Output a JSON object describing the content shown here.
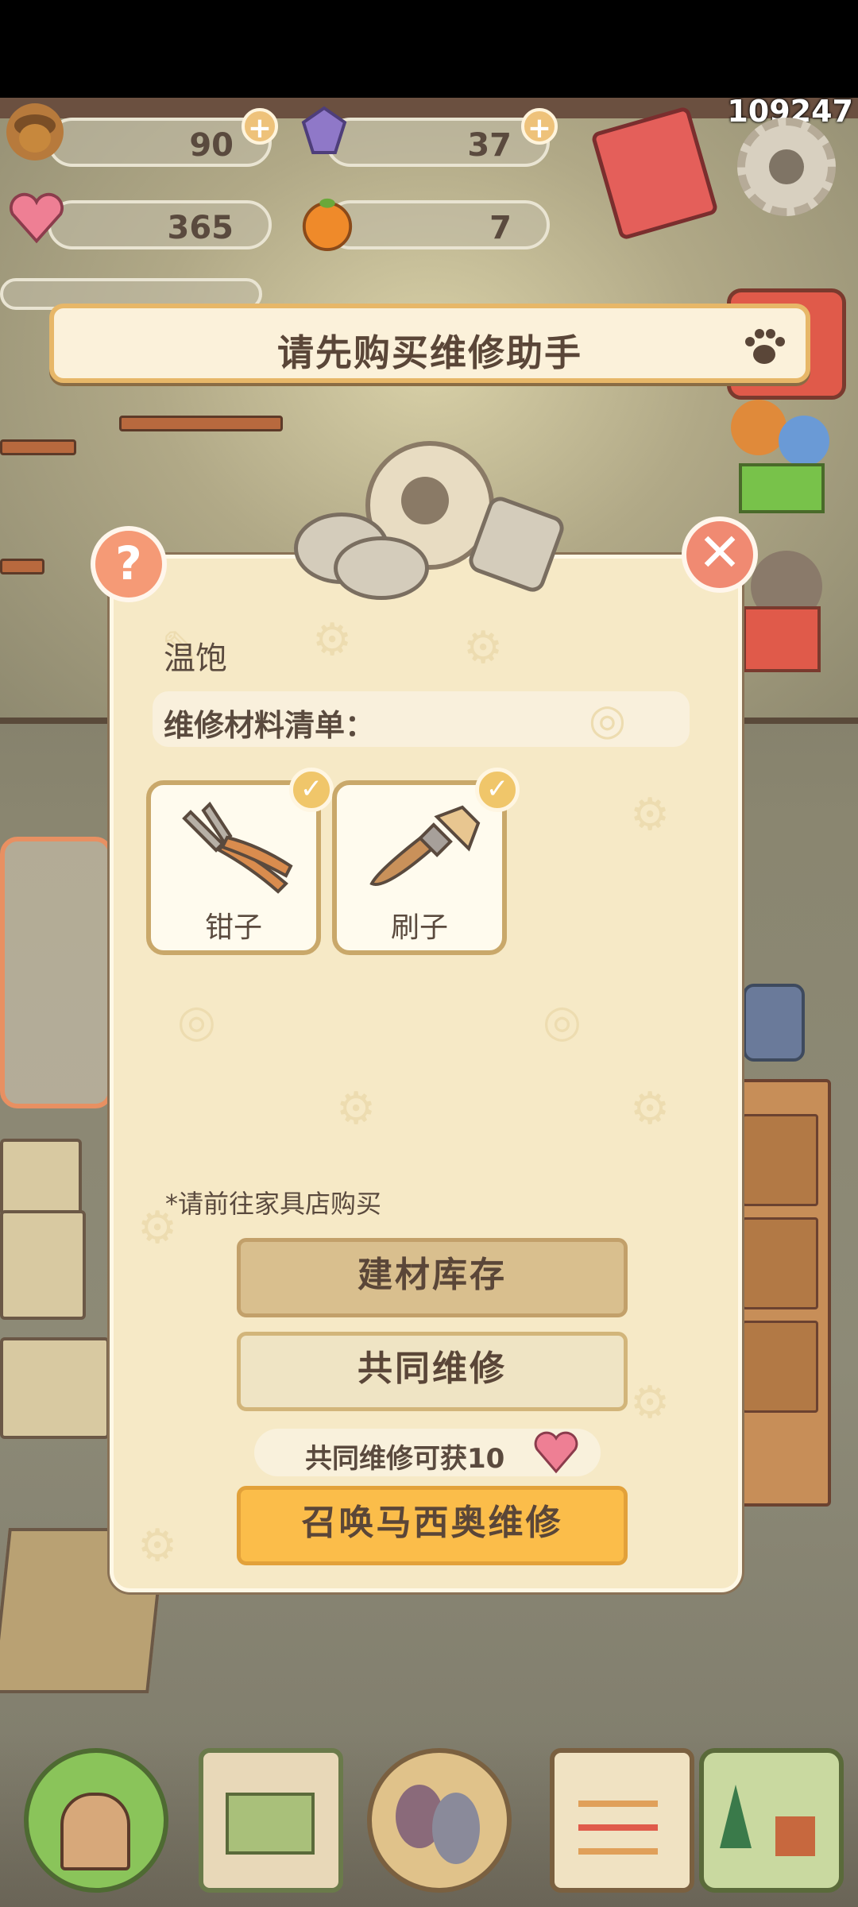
{
  "hud": {
    "acorns": "90",
    "gems": "37",
    "hearts": "365",
    "oranges": "7",
    "counter": "109247",
    "icons": [
      "acorn-icon",
      "gem-icon",
      "heart-gem-icon",
      "orange-icon",
      "plus-icon",
      "gear-icon",
      "mail-card-icon"
    ]
  },
  "banner": {
    "text": "请先购买维修助手",
    "icon": "paw-icon"
  },
  "dialog": {
    "item_name": "温饱",
    "list_title": "维修材料清单：",
    "materials": [
      {
        "name": "钳子",
        "icon": "pliers-icon",
        "checked": true
      },
      {
        "name": "刷子",
        "icon": "brush-icon",
        "checked": true
      }
    ],
    "note": "*请前往家具店购买",
    "stock_button": "建材库存",
    "coop_button": "共同维修",
    "reward_text": "共同维修可获10",
    "summon_button": "召唤马西奥维修",
    "help_icon": "?",
    "close_icon": "✕"
  },
  "colors": {
    "accent": "#fbbd4a",
    "panel": "#f6e9c6",
    "text": "#5a4638",
    "close": "#f08a72"
  }
}
